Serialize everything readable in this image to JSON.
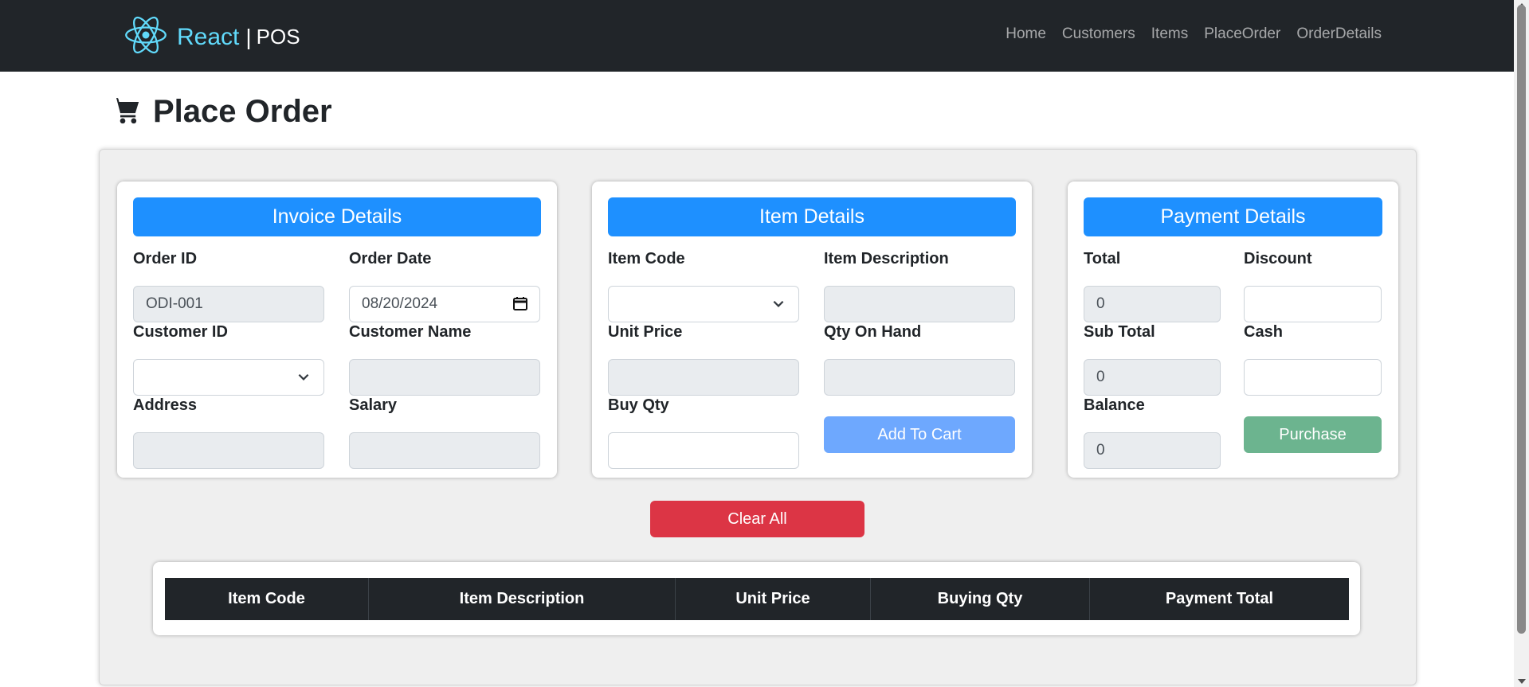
{
  "navbar": {
    "brand_react": "React",
    "brand_sep": "|",
    "brand_pos": "POS",
    "links": [
      "Home",
      "Customers",
      "Items",
      "PlaceOrder",
      "OrderDetails"
    ]
  },
  "page": {
    "title": "Place Order"
  },
  "invoice": {
    "header": "Invoice Details",
    "order_id_label": "Order ID",
    "order_id_value": "ODI-001",
    "order_date_label": "Order Date",
    "order_date_value": "08/20/2024",
    "customer_id_label": "Customer ID",
    "customer_id_value": "",
    "customer_name_label": "Customer Name",
    "customer_name_value": "",
    "address_label": "Address",
    "address_value": "",
    "salary_label": "Salary",
    "salary_value": ""
  },
  "item": {
    "header": "Item Details",
    "item_code_label": "Item Code",
    "item_code_value": "",
    "item_desc_label": "Item Description",
    "item_desc_value": "",
    "unit_price_label": "Unit Price",
    "unit_price_value": "",
    "qty_on_hand_label": "Qty On Hand",
    "qty_on_hand_value": "",
    "buy_qty_label": "Buy Qty",
    "buy_qty_value": "",
    "add_to_cart": "Add To Cart"
  },
  "payment": {
    "header": "Payment Details",
    "total_label": "Total",
    "total_value": "0",
    "discount_label": "Discount",
    "discount_value": "",
    "sub_total_label": "Sub Total",
    "sub_total_value": "0",
    "cash_label": "Cash",
    "cash_value": "",
    "balance_label": "Balance",
    "balance_value": "0",
    "purchase": "Purchase"
  },
  "actions": {
    "clear_all": "Clear All"
  },
  "cart_table": {
    "columns": [
      "Item Code",
      "Item Description",
      "Unit Price",
      "Buying Qty",
      "Payment Total"
    ]
  },
  "colors": {
    "navbar_bg": "#212529",
    "brand_accent": "#61dafb",
    "card_header": "#1e90ff",
    "add_to_cart": "#6ea8fe",
    "purchase": "#6cb48f",
    "clear_all": "#dc3545"
  },
  "icons": {
    "brand": "react-atom-icon",
    "title": "shopping-cart-icon",
    "select": "chevron-down-icon",
    "date": "calendar-icon"
  }
}
